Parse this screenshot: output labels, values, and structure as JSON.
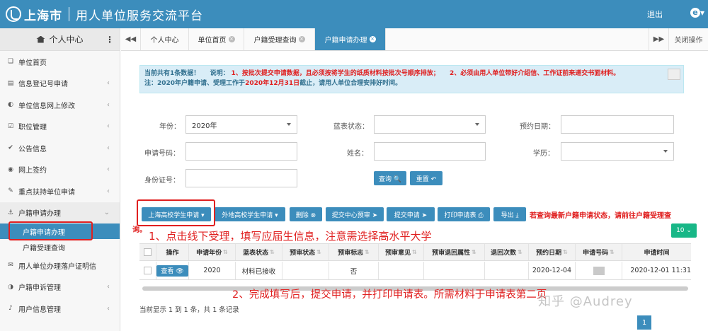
{
  "header": {
    "logo_text": "上海市",
    "platform_title": "用人单位服务交流平台",
    "logout_label": "退出",
    "user_caret": "▾"
  },
  "sidebar": {
    "title": "个人中心",
    "more_label": "⋮",
    "items": [
      {
        "label": "单位首页",
        "icon": "bookmark-icon",
        "glyph": "❏",
        "chevron": ""
      },
      {
        "label": "信息登记号申请",
        "icon": "file-icon",
        "glyph": "▤",
        "chevron": "‹"
      },
      {
        "label": "单位信息网上修改",
        "icon": "contrast-icon",
        "glyph": "◐",
        "chevron": "‹"
      },
      {
        "label": "职位管理",
        "icon": "checkbox-icon",
        "glyph": "☑",
        "chevron": "‹"
      },
      {
        "label": "公告信息",
        "icon": "check-icon",
        "glyph": "✔",
        "chevron": "‹"
      },
      {
        "label": "网上签约",
        "icon": "eye-icon",
        "glyph": "◉",
        "chevron": "‹"
      },
      {
        "label": "重点扶持单位申请",
        "icon": "pencil-icon",
        "glyph": "✎",
        "chevron": "‹"
      },
      {
        "label": "户籍申请办理",
        "icon": "anchor-icon",
        "glyph": "⚓",
        "chevron": "⌄"
      }
    ],
    "sub_items": [
      {
        "label": "户籍申请办理"
      },
      {
        "label": "户籍受理查询"
      }
    ],
    "items_after": [
      {
        "label": "用人单位办理落户证明信",
        "icon": "envelope-icon",
        "glyph": "✉",
        "chevron": ""
      },
      {
        "label": "户籍申诉管理",
        "icon": "contrast-icon",
        "glyph": "◑",
        "chevron": "‹"
      },
      {
        "label": "用户信息管理",
        "icon": "bell-icon",
        "glyph": "♪",
        "chevron": "‹"
      }
    ]
  },
  "tabs": {
    "prev": "◀◀",
    "next": "▶▶",
    "close_ops": "关闭操作",
    "items": [
      {
        "label": "个人中心",
        "closable": false
      },
      {
        "label": "单位首页",
        "closable": true
      },
      {
        "label": "户籍受理查询",
        "closable": true
      },
      {
        "label": "户籍申请办理",
        "closable": true
      }
    ]
  },
  "notice": {
    "count": "当前共有1条数据！",
    "note_label": "说明：",
    "point1": "1、按批次提交申请数据，且必须按将学生的纸质材料按批次号顺序排放；",
    "point2": "2、必须由用人单位带好介绍信、工作证前来递交书面材料。",
    "line2_prefix": "注：2020年户籍申请、受理工作于",
    "deadline": "2020年12月31日",
    "line2_suffix": "截止，请用人单位合理安排好时间。"
  },
  "form": {
    "year_label": "年份：",
    "year_value": "2020年",
    "blue_status_label": "蓝表状态：",
    "appointment_label": "预约日期：",
    "app_no_label": "申请号码：",
    "name_label": "姓名：",
    "education_label": "学历：",
    "id_label": "身份证号：",
    "search_btn": "查询 🔍",
    "reset_btn": "重置 ↶"
  },
  "toolbar": {
    "btn_sh": "上海高校学生申请 ▾",
    "btn_other": "外地高校学生申请 ▾",
    "btn_delete": "删除 ⊗",
    "btn_submit_center": "提交中心预审 ➤",
    "btn_submit": "提交申请 ➤",
    "btn_print": "打印申请表 ⎙",
    "btn_export": "导出 ⤓",
    "hint_text": "若查询最新户籍申请状态，请前往户籍受理查",
    "hint_wrap": "询。",
    "page_size": "10 ⌄"
  },
  "annotations": {
    "step1": "1、点击线下受理，填写应届生信息，注意需选择高水平大学",
    "step2": "2、完成填写后，提交申请，并打印申请表。所需材料于申请表第二页",
    "watermark": "知乎 @Audrey"
  },
  "table": {
    "columns": [
      "",
      "操作",
      "申请年份",
      "蓝表状态",
      "预审状态",
      "预审标志",
      "预审意见",
      "预审退回属性",
      "退回次数",
      "预约日期",
      "申请号码",
      "申请时间"
    ],
    "row": {
      "view_btn": "查看 👁",
      "year": "2020",
      "blue_status": "材料已接收",
      "pre_status": "",
      "pre_flag": "否",
      "pre_opinion": "",
      "pre_return": "",
      "return_count": "",
      "appoint_date": "2020-12-04",
      "app_time": "2020-12-01 11:31"
    }
  },
  "footer": {
    "info": "当前显示 1 到 1 条，共 1 条记录",
    "page": "1"
  }
}
